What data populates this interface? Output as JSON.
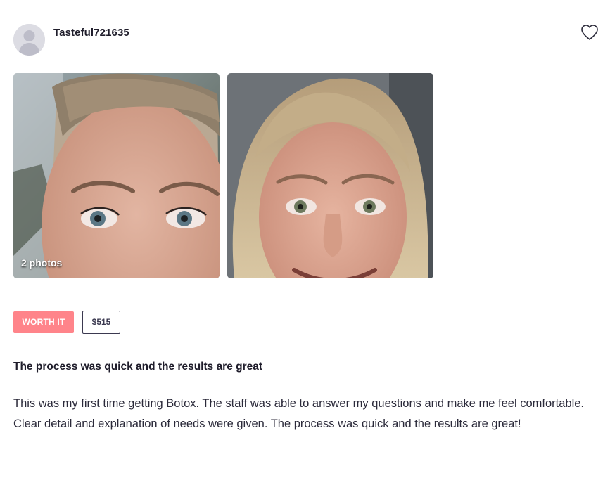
{
  "review": {
    "username": "Tasteful721635",
    "photos": {
      "count_label": "2 photos",
      "items": [
        {
          "icon": "photo-before-face"
        },
        {
          "icon": "photo-after-face"
        }
      ]
    },
    "badges": {
      "worth_it": "WORTH IT",
      "price": "$515"
    },
    "title": "The process was quick and the results are great",
    "body": "This was my first time getting Botox. The staff was able to answer my questions and make me feel comfortable. Clear detail and explanation of needs were given. The process was quick and the results are great!"
  },
  "colors": {
    "worth_it_bg": "#ff848a",
    "text_primary": "#1f1d2b",
    "avatar_bg": "#dcdce3"
  },
  "icons": {
    "favorite": "heart-icon",
    "avatar": "default-user-avatar"
  }
}
